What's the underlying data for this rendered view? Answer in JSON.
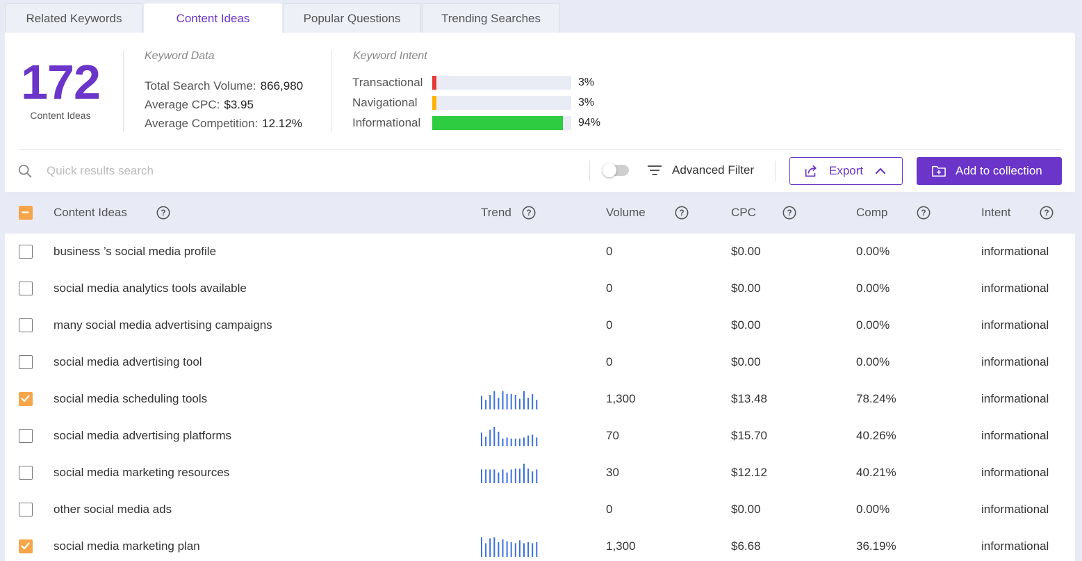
{
  "tabs": [
    {
      "label": "Related Keywords",
      "active": false
    },
    {
      "label": "Content Ideas",
      "active": true
    },
    {
      "label": "Popular Questions",
      "active": false
    },
    {
      "label": "Trending Searches",
      "active": false
    }
  ],
  "summary": {
    "count": "172",
    "count_label": "Content Ideas",
    "keyword_data_title": "Keyword Data",
    "total_search_volume_label": "Total Search Volume:",
    "total_search_volume": "866,980",
    "average_cpc_label": "Average CPC:",
    "average_cpc": "$3.95",
    "average_competition_label": "Average Competition:",
    "average_competition": "12.12%"
  },
  "intent": {
    "title": "Keyword Intent",
    "rows": [
      {
        "label": "Transactional",
        "pct_text": "3%",
        "value": 3,
        "color": "#e53935"
      },
      {
        "label": "Navigational",
        "pct_text": "3%",
        "value": 3,
        "color": "#ffb300"
      },
      {
        "label": "Informational",
        "pct_text": "94%",
        "value": 94,
        "color": "#2ecc40"
      }
    ]
  },
  "toolbar": {
    "search_placeholder": "Quick results search",
    "filter_toggle_on": false,
    "advanced_filter_label": "Advanced Filter",
    "export_label": "Export",
    "add_collection_label": "Add to collection"
  },
  "table": {
    "headers": {
      "idea": "Content Ideas",
      "trend": "Trend",
      "volume": "Volume",
      "cpc": "CPC",
      "comp": "Comp",
      "intent": "Intent"
    },
    "select_all_state": "indeterminate",
    "rows": [
      {
        "checked": false,
        "idea": "business ’s social media profile",
        "trend": [],
        "volume": "0",
        "cpc": "$0.00",
        "comp": "0.00%",
        "intent": "informational"
      },
      {
        "checked": false,
        "idea": "social media analytics tools available",
        "trend": [],
        "volume": "0",
        "cpc": "$0.00",
        "comp": "0.00%",
        "intent": "informational"
      },
      {
        "checked": false,
        "idea": "many social media advertising campaigns",
        "trend": [],
        "volume": "0",
        "cpc": "$0.00",
        "comp": "0.00%",
        "intent": "informational"
      },
      {
        "checked": false,
        "idea": "social media advertising tool",
        "trend": [],
        "volume": "0",
        "cpc": "$0.00",
        "comp": "0.00%",
        "intent": "informational"
      },
      {
        "checked": true,
        "idea": "social media scheduling tools",
        "trend": [
          0.7,
          0.5,
          0.75,
          0.95,
          0.6,
          0.95,
          0.8,
          0.8,
          0.75,
          0.55,
          0.95,
          0.6,
          0.8,
          0.5
        ],
        "volume": "1,300",
        "cpc": "$13.48",
        "comp": "78.24%",
        "intent": "informational"
      },
      {
        "checked": false,
        "idea": "social media advertising platforms",
        "trend": [
          0.7,
          0.5,
          0.85,
          1.0,
          0.75,
          0.4,
          0.45,
          0.4,
          0.4,
          0.4,
          0.45,
          0.55,
          0.6,
          0.45
        ],
        "volume": "70",
        "cpc": "$15.70",
        "comp": "40.26%",
        "intent": "informational"
      },
      {
        "checked": false,
        "idea": "social media marketing resources",
        "trend": [
          0.7,
          0.7,
          0.7,
          0.7,
          0.55,
          0.7,
          0.55,
          0.7,
          0.75,
          0.75,
          1.0,
          0.75,
          0.6,
          0.7
        ],
        "volume": "30",
        "cpc": "$12.12",
        "comp": "40.21%",
        "intent": "informational"
      },
      {
        "checked": false,
        "idea": "other social media ads",
        "trend": [],
        "volume": "0",
        "cpc": "$0.00",
        "comp": "0.00%",
        "intent": "informational"
      },
      {
        "checked": true,
        "idea": "social media marketing plan",
        "trend": [
          1.0,
          0.7,
          0.95,
          1.0,
          0.75,
          0.9,
          0.8,
          0.75,
          0.7,
          0.85,
          0.7,
          0.75,
          0.7,
          0.75
        ],
        "volume": "1,300",
        "cpc": "$6.68",
        "comp": "36.19%",
        "intent": "informational"
      }
    ]
  },
  "colors": {
    "accent": "#6a35c8",
    "checkbox_checked": "#f7a54a",
    "trend_bar": "#3b6fe0"
  }
}
